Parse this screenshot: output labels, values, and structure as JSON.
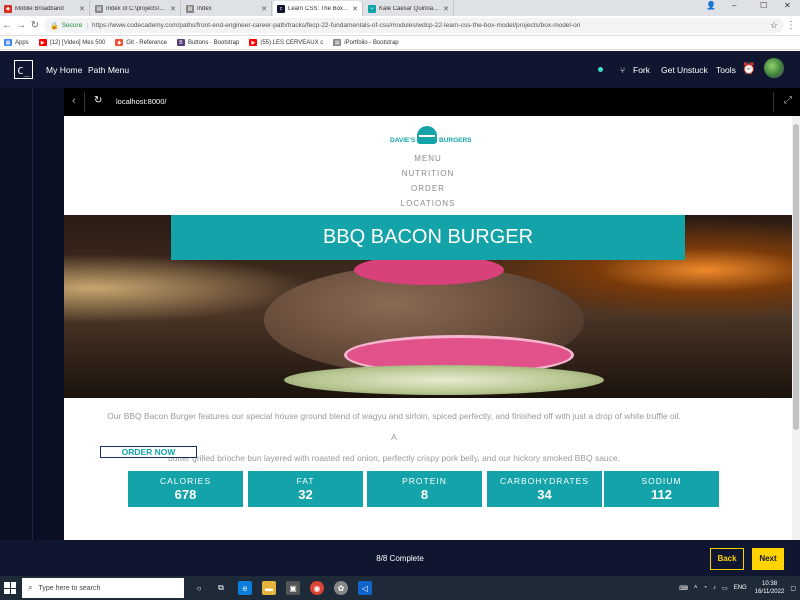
{
  "browser": {
    "tabs": [
      {
        "label": "Mobile Broadband",
        "icon": "mobile-broadband-favicon",
        "color": "#d93025"
      },
      {
        "label": "Index of C:\\projects\\Port",
        "icon": "file-favicon",
        "color": "#888888"
      },
      {
        "label": "Index",
        "icon": "file-favicon",
        "color": "#888888"
      },
      {
        "label": "Learn CSS: The Box Mod",
        "icon": "codecademy-favicon",
        "color": "#10162f",
        "active": true
      },
      {
        "label": "Kale Caesar Quinoa Sala",
        "icon": "page-favicon",
        "color": "#14a3a8"
      }
    ],
    "window_controls": {
      "profile": "person-icon",
      "minimize": "–",
      "maximize": "☐",
      "close": "✕"
    },
    "secure_label": "Secure",
    "url": "https://www.codecademy.com/paths/front-end-engineer-career-path/tracks/fecp-22-fundamentals-of-css/modules/wdcp-22-learn-css-the-box-model/projects/box-model-on",
    "bookmarks": [
      {
        "label": "Apps",
        "color": "#4285f4"
      },
      {
        "label": "(12) [Video] Mes 500",
        "color": "#ff0000"
      },
      {
        "label": "Git - Reference",
        "color": "#f05033"
      },
      {
        "label": "Buttons · Bootstrap",
        "color": "#563d7c"
      },
      {
        "label": "(55) LES CERVEAUX c",
        "color": "#ff0000"
      },
      {
        "label": "iPortfolio - Bootstrap",
        "color": "#888888"
      }
    ]
  },
  "codecademy": {
    "logo": "C_",
    "nav": {
      "my_home": "My Home",
      "path_menu": "Path Menu",
      "fork": "Fork",
      "get_unstuck": "Get Unstuck",
      "tools": "Tools"
    },
    "preview_url": "localhost:8000/",
    "progress": "8/8 Complete",
    "back_label": "Back",
    "next_label": "Next"
  },
  "site": {
    "logo_left": "DAVIE'S",
    "logo_right": "BURGERS",
    "nav": [
      "MENU",
      "NUTRITION",
      "ORDER",
      "LOCATIONS"
    ],
    "hero_title": "BBQ BACON BURGER",
    "description_line1": "Our BBQ Bacon Burger features our special house ground blend of wagyu and sirloin, spiced perfectly, and finished off with just a drop of white truffle oil. A",
    "description_line2": "butter grilled brioche bun layered with roasted red onion, perfectly crispy pork belly, and our hickory smoked BBQ sauce.",
    "order_button": "ORDER NOW",
    "nutrition": [
      {
        "label": "CALORIES",
        "value": "678"
      },
      {
        "label": "FAT",
        "value": "32"
      },
      {
        "label": "PROTEIN",
        "value": "8"
      },
      {
        "label": "CARBOHYDRATES",
        "value": "34"
      },
      {
        "label": "SODIUM",
        "value": "112"
      }
    ],
    "accent_color": "#14a3a8"
  },
  "taskbar": {
    "search_placeholder": "Type here to search",
    "apps": [
      "task-view-icon",
      "edge-icon",
      "file-explorer-icon",
      "store-icon",
      "chrome-icon",
      "app-icon",
      "vscode-icon"
    ],
    "language": "ENG",
    "time": "10:38",
    "date": "16/11/2022"
  }
}
